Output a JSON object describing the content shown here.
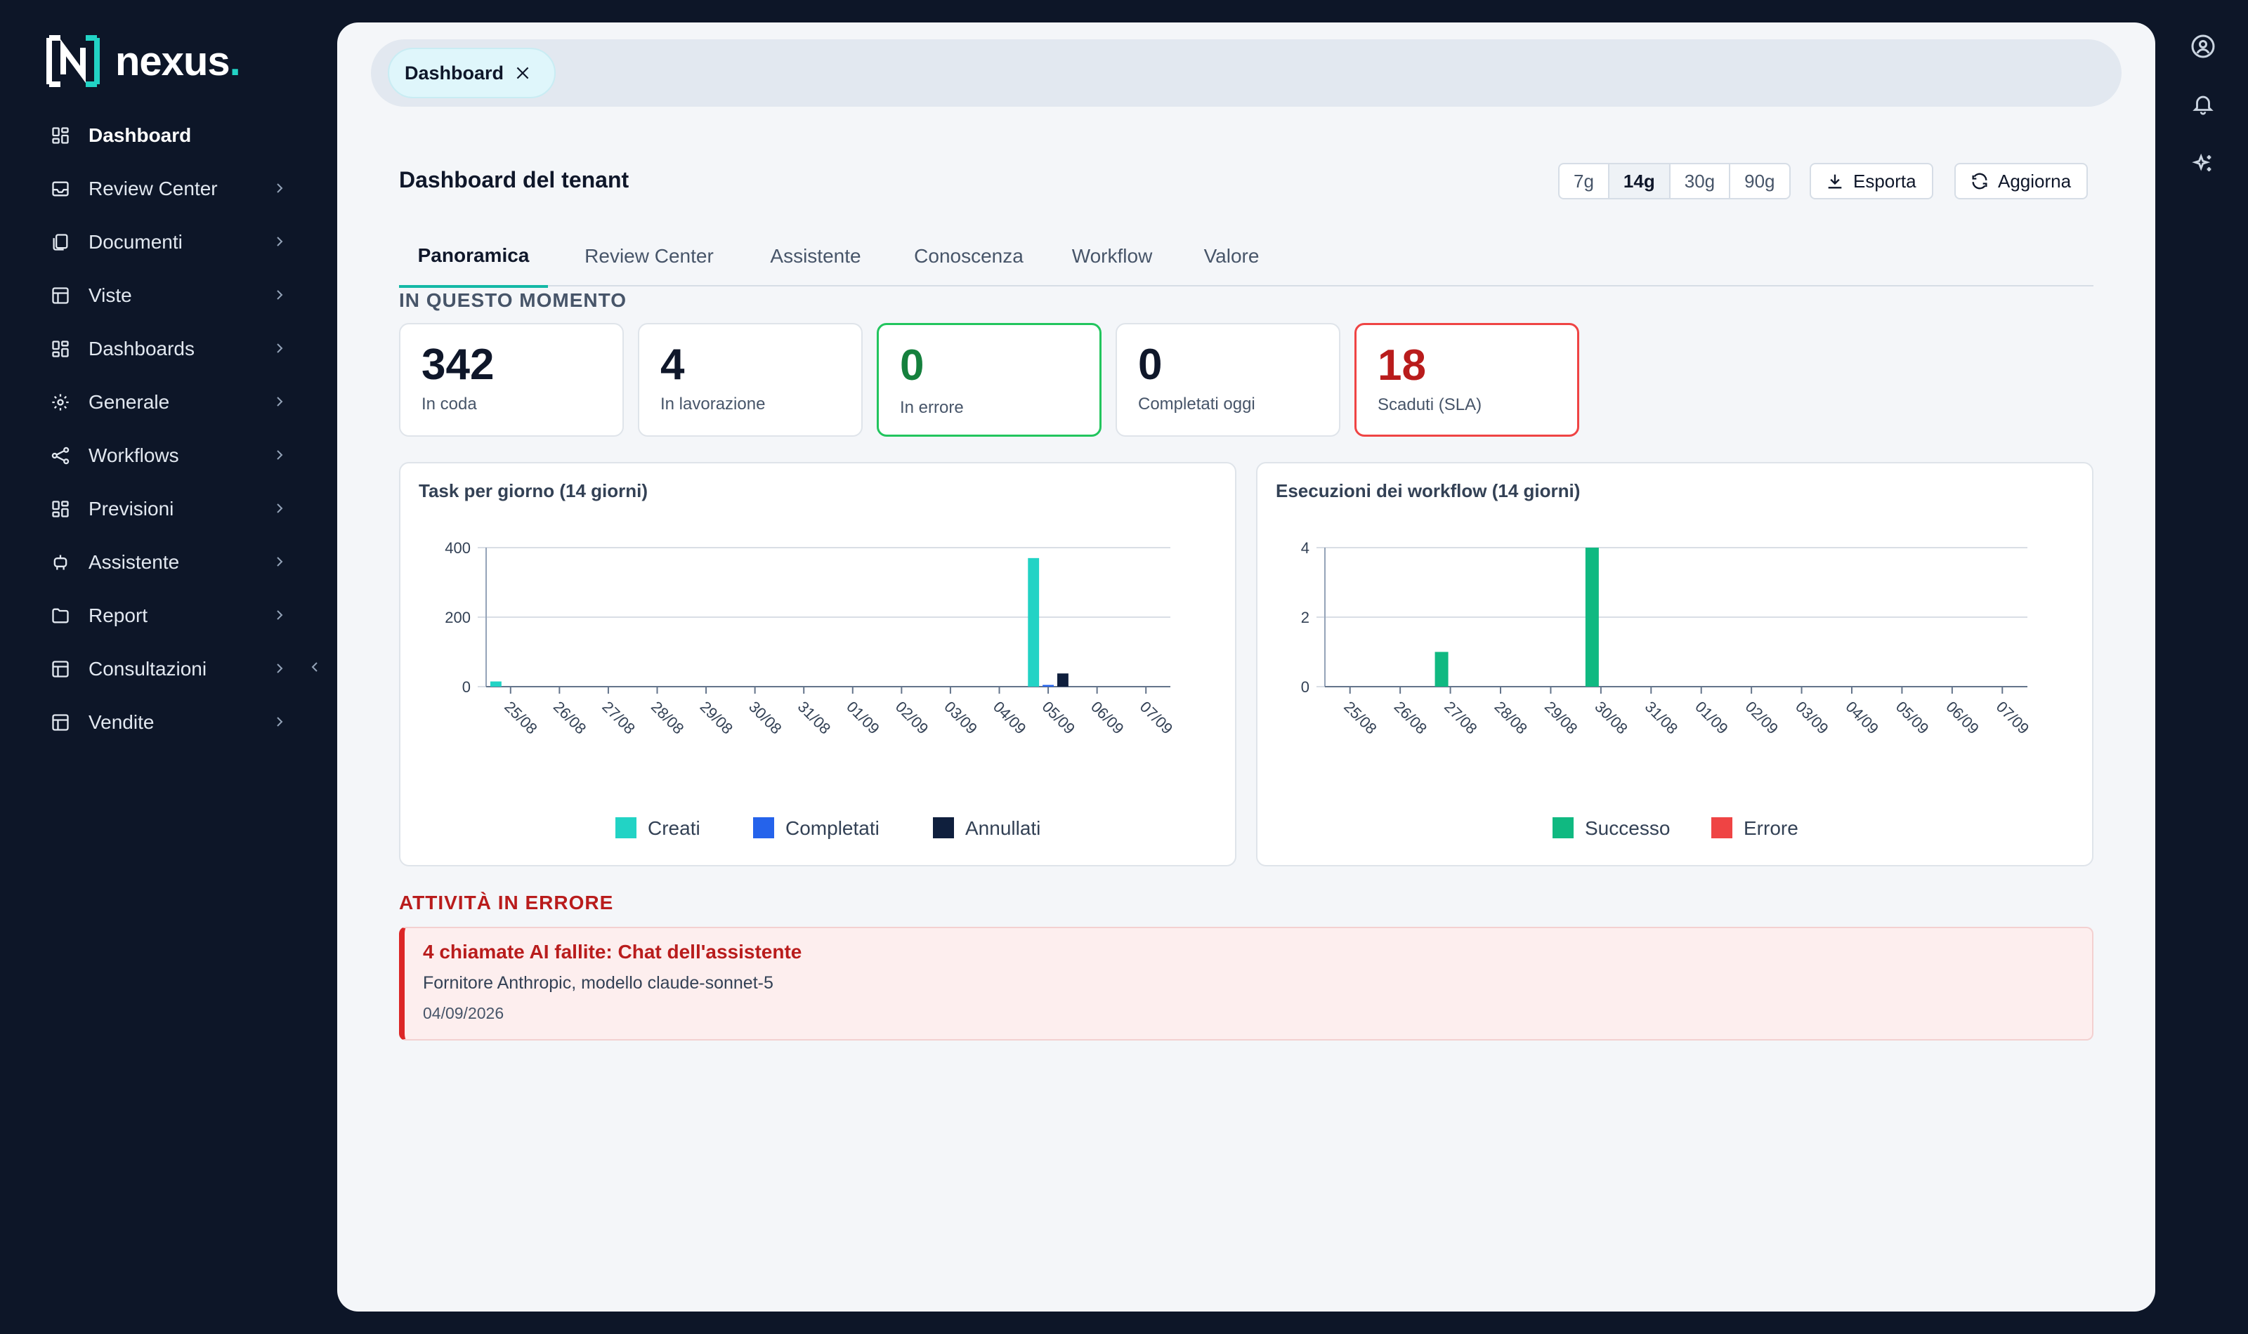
{
  "app": {
    "name": "nexus",
    "dot": ".",
    "colors": {
      "sidebar_bg": "#0d1628",
      "accent": "#22d3c5",
      "brand_teal": "#14b8a6"
    }
  },
  "sidebar": {
    "items": [
      {
        "label": "Dashboard",
        "icon": "grid-icon",
        "active": true
      },
      {
        "label": "Review Center",
        "icon": "inbox-icon"
      },
      {
        "label": "Documenti",
        "icon": "documents-icon"
      },
      {
        "label": "Viste",
        "icon": "table-icon"
      },
      {
        "label": "Dashboards",
        "icon": "grid-icon"
      },
      {
        "label": "Generale",
        "icon": "gear-icon"
      },
      {
        "label": "Workflows",
        "icon": "share-icon"
      },
      {
        "label": "Previsioni",
        "icon": "grid-icon"
      },
      {
        "label": "Assistente",
        "icon": "robot-icon"
      },
      {
        "label": "Report",
        "icon": "folder-icon"
      },
      {
        "label": "Consultazioni",
        "icon": "table-icon"
      },
      {
        "label": "Vendite",
        "icon": "table-icon"
      }
    ]
  },
  "open_tab": {
    "label": "Dashboard"
  },
  "header": {
    "title": "Dashboard del tenant",
    "ranges": [
      "7g",
      "14g",
      "30g",
      "90g"
    ],
    "selected_range": "14g",
    "export_label": "Esporta",
    "refresh_label": "Aggiorna"
  },
  "subtabs": [
    "Panoramica",
    "Review Center",
    "Assistente",
    "Conoscenza",
    "Workflow",
    "Valore"
  ],
  "now_section": {
    "title": "IN QUESTO MOMENTO",
    "kpis": [
      {
        "value": "342",
        "label": "In coda"
      },
      {
        "value": "4",
        "label": "In lavorazione"
      },
      {
        "value": "0",
        "label": "In errore",
        "status": "green"
      },
      {
        "value": "0",
        "label": "Completati oggi"
      },
      {
        "value": "18",
        "label": "Scaduti (SLA)",
        "status": "red"
      }
    ]
  },
  "chart_data": [
    {
      "type": "bar",
      "title": "Task per giorno (14 giorni)",
      "categories": [
        "25/08",
        "26/08",
        "27/08",
        "28/08",
        "29/08",
        "30/08",
        "31/08",
        "01/09",
        "02/09",
        "03/09",
        "04/09",
        "05/09",
        "06/09",
        "07/09"
      ],
      "ylim": [
        0,
        400
      ],
      "yticks": [
        "0",
        "200",
        "400"
      ],
      "grid": true,
      "legend": "bottom",
      "series": [
        {
          "name": "Creati",
          "color": "#22d3c5",
          "values": [
            15,
            0,
            0,
            0,
            0,
            0,
            0,
            0,
            0,
            0,
            0,
            370,
            0,
            0
          ]
        },
        {
          "name": "Completati",
          "color": "#2563eb",
          "values": [
            0,
            0,
            0,
            0,
            0,
            0,
            0,
            0,
            0,
            0,
            0,
            5,
            0,
            0
          ]
        },
        {
          "name": "Annullati",
          "color": "#0f1f3d",
          "values": [
            0,
            0,
            0,
            0,
            0,
            0,
            0,
            0,
            0,
            0,
            0,
            38,
            0,
            0
          ]
        }
      ]
    },
    {
      "type": "bar",
      "title": "Esecuzioni dei workflow (14 giorni)",
      "categories": [
        "25/08",
        "26/08",
        "27/08",
        "28/08",
        "29/08",
        "30/08",
        "31/08",
        "01/09",
        "02/09",
        "03/09",
        "04/09",
        "05/09",
        "06/09",
        "07/09"
      ],
      "ylim": [
        0,
        4
      ],
      "yticks": [
        "0",
        "2",
        "4"
      ],
      "grid": true,
      "legend": "bottom",
      "series": [
        {
          "name": "Successo",
          "color": "#10b981",
          "values": [
            0,
            0,
            1,
            0,
            0,
            4,
            0,
            0,
            0,
            0,
            0,
            0,
            0,
            0
          ]
        },
        {
          "name": "Errore",
          "color": "#ef4444",
          "values": [
            0,
            0,
            0,
            0,
            0,
            0,
            0,
            0,
            0,
            0,
            0,
            0,
            0,
            0
          ]
        }
      ]
    }
  ],
  "errors_section": {
    "title": "ATTIVITÀ IN ERRORE",
    "items": [
      {
        "title": "4 chiamate AI fallite: Chat dell'assistente",
        "subtitle": "Fornitore Anthropic, modello claude-sonnet-5",
        "date": "04/09/2026"
      }
    ]
  }
}
